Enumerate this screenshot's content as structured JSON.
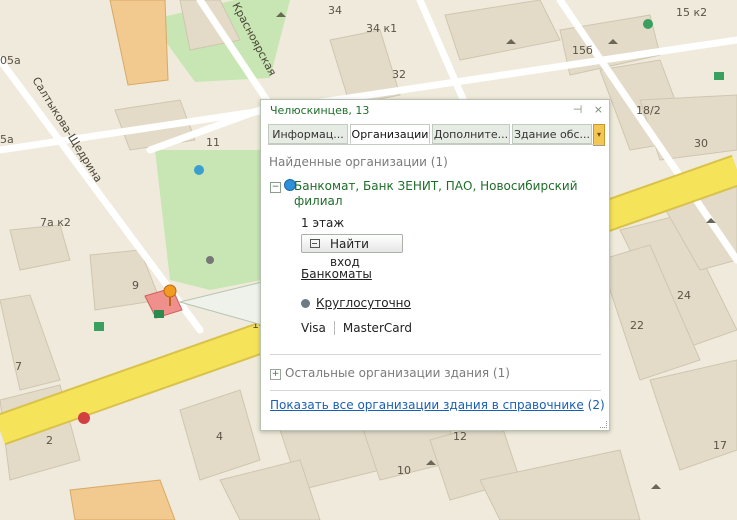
{
  "map": {
    "street_labels": [
      "Салтыкова-Щедрина",
      "Красноярская"
    ],
    "building_labels": [
      "34",
      "15 к2",
      "34 к1",
      "05а",
      "32",
      "15б",
      "18/2",
      "11",
      "30",
      "5а",
      "7а к2",
      "9",
      "24",
      "22",
      "7",
      "2",
      "4",
      "12",
      "10",
      "17",
      "14"
    ],
    "colors": {
      "road_major": "#f5e35a",
      "road_minor": "#ffffff",
      "ground": "#efeadb",
      "park": "#c8e6b4",
      "building": "#e6dfcd"
    }
  },
  "popup": {
    "title": "Челюскинцев, 13",
    "controls": {
      "pin_label": "⊣",
      "close_label": "×"
    },
    "tabs": [
      {
        "label": "Информац..."
      },
      {
        "label": "Организации"
      },
      {
        "label": "Дополните..."
      },
      {
        "label": "Здание обс..."
      }
    ],
    "tab_more_label": "▾",
    "found_header": "Найденные организации (1)",
    "org": {
      "toggle": "−",
      "name": "Банкомат, Банк ЗЕНИТ, ПАО, Новосибирский филиал",
      "floor": "1 этаж",
      "find_entrance": "Найти вход",
      "category": "Банкоматы",
      "hours": "Круглосуточно",
      "payments": [
        "Visa",
        "MasterCard"
      ]
    },
    "other_toggle": "+",
    "other_orgs": "Остальные организации здания (1)",
    "show_all_link": "Показать все организации здания в справочнике",
    "show_all_count": "(2)"
  }
}
